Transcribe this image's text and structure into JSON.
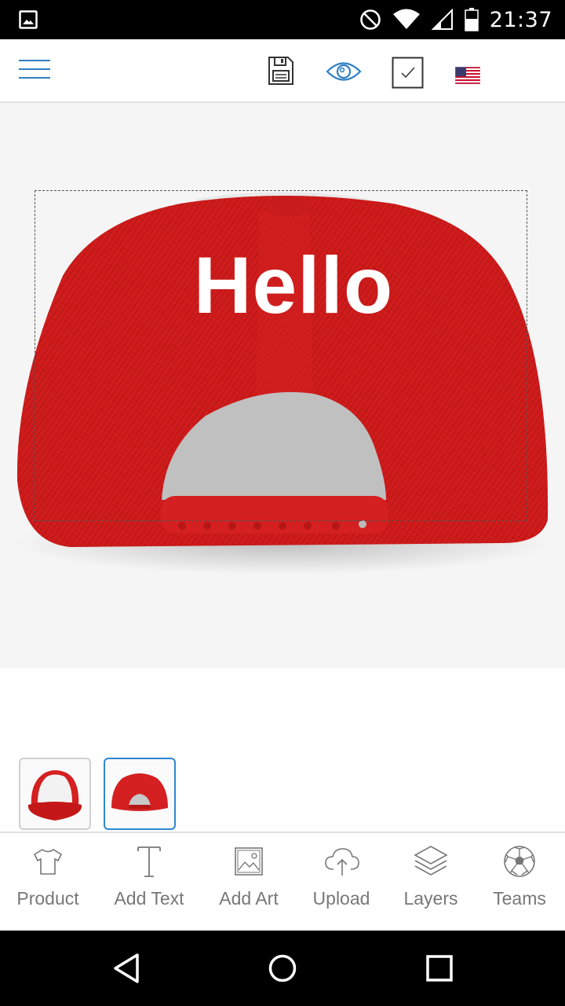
{
  "status_bar": {
    "time": "21:37",
    "icons": [
      "gallery-icon",
      "do-not-disturb-icon",
      "wifi-icon",
      "signal-icon",
      "battery-icon"
    ]
  },
  "toolbar": {
    "icons": [
      "menu-icon",
      "save-icon",
      "preview-eye-icon",
      "checkbox-icon",
      "us-flag-icon"
    ],
    "accent_color": "#2f7fc2"
  },
  "design": {
    "text": "Hello",
    "text_color": "#ffffff",
    "product_color": "#d42020"
  },
  "thumbnails": [
    {
      "view": "front",
      "selected": false
    },
    {
      "view": "back",
      "selected": true
    }
  ],
  "bottom_menu": {
    "items": [
      {
        "label": "Product",
        "icon": "tshirt-icon"
      },
      {
        "label": "Add Text",
        "icon": "text-icon"
      },
      {
        "label": "Add Art",
        "icon": "image-icon"
      },
      {
        "label": "Upload",
        "icon": "cloud-upload-icon"
      },
      {
        "label": "Layers",
        "icon": "layers-icon"
      },
      {
        "label": "Teams",
        "icon": "soccer-ball-icon"
      }
    ],
    "label_color": "#777777"
  },
  "nav_bar": {
    "icons": [
      "back-icon",
      "home-icon",
      "recents-icon"
    ]
  }
}
